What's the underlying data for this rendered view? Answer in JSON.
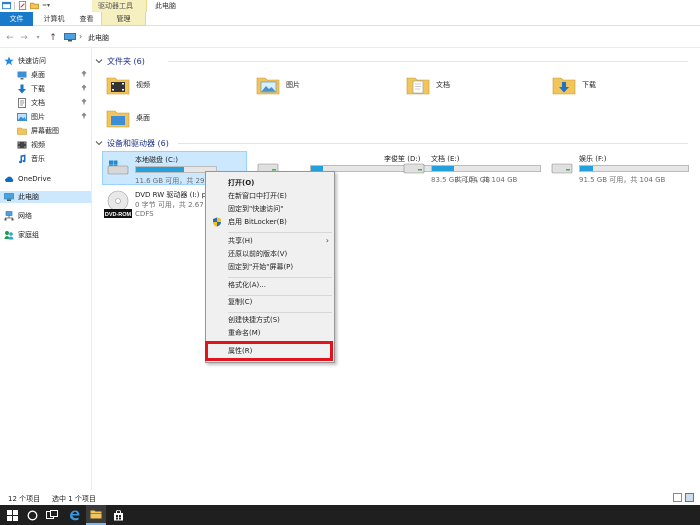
{
  "window": {
    "title": "此电脑",
    "contextual_tab_group": "驱动器工具"
  },
  "ribbon": {
    "tabs": [
      "文件",
      "计算机",
      "查看",
      "管理"
    ]
  },
  "address": {
    "path": "此电脑"
  },
  "nav": {
    "items": [
      {
        "label": "快速访问",
        "icon": "star-icon",
        "pinned": false
      },
      {
        "label": "桌面",
        "icon": "desktop-icon",
        "pinned": true
      },
      {
        "label": "下载",
        "icon": "download-icon",
        "pinned": true
      },
      {
        "label": "文档",
        "icon": "documents-icon",
        "pinned": true
      },
      {
        "label": "图片",
        "icon": "pictures-icon",
        "pinned": true
      },
      {
        "label": "屏幕截图",
        "icon": "folder-icon",
        "pinned": false
      },
      {
        "label": "视频",
        "icon": "video-icon",
        "pinned": false
      },
      {
        "label": "音乐",
        "icon": "music-icon",
        "pinned": false
      },
      {
        "label": "OneDrive",
        "icon": "cloud-icon",
        "pinned": false
      },
      {
        "label": "此电脑",
        "icon": "computer-icon",
        "pinned": false,
        "selected": true
      },
      {
        "label": "网络",
        "icon": "network-icon",
        "pinned": false
      },
      {
        "label": "家庭组",
        "icon": "homegroup-icon",
        "pinned": false
      }
    ]
  },
  "folders": {
    "header": "文件夹 (6)",
    "items": [
      "视频",
      "图片",
      "文档",
      "下载",
      "桌面"
    ]
  },
  "devices": {
    "header": "设备和驱动器 (6)",
    "drives": [
      {
        "name": "本地磁盘 (C:)",
        "free": "11.6 GB 可用，共 29.2",
        "used_fraction": 0.6,
        "selected": true
      },
      {
        "name": "李俊笙 (D:)",
        "free": "共 104 GB",
        "used_fraction": 0.1
      },
      {
        "name": "文档 (E:)",
        "free": "83.5 GB 可用，共 104 GB",
        "used_fraction": 0.2
      },
      {
        "name": "娱乐 (F:)",
        "free": "91.5 GB 可用，共 104 GB",
        "used_fraction": 0.12
      }
    ],
    "dvd": {
      "name": "DVD RW 驱动器 (I:) p",
      "free": "0 字节 可用，共 2.67",
      "fs": "CDFS",
      "badge": "DVD-ROM"
    }
  },
  "context_menu": {
    "items": [
      {
        "label": "打开(O)",
        "bold": true
      },
      {
        "label": "在新窗口中打开(E)"
      },
      {
        "label": "固定到\"快速访问\""
      },
      {
        "label": "启用 BitLocker(B)",
        "icon": "shield-icon"
      },
      {
        "sep": true
      },
      {
        "label": "共享(H)",
        "submenu": true
      },
      {
        "label": "还原以前的版本(V)"
      },
      {
        "label": "固定到\"开始\"屏幕(P)"
      },
      {
        "sep": true
      },
      {
        "label": "格式化(A)..."
      },
      {
        "sep": true
      },
      {
        "label": "复制(C)"
      },
      {
        "sep": true
      },
      {
        "label": "创建快捷方式(S)"
      },
      {
        "label": "重命名(M)"
      },
      {
        "sep": true
      },
      {
        "label": "属性(R)",
        "highlighted": true
      }
    ]
  },
  "status": {
    "count": "12 个项目",
    "selection": "选中 1 个项目"
  },
  "colors": {
    "accent": "#1979ca",
    "selection": "#cce8ff",
    "highlight_box": "#e0141c",
    "drive_bar": "#26a0da"
  }
}
